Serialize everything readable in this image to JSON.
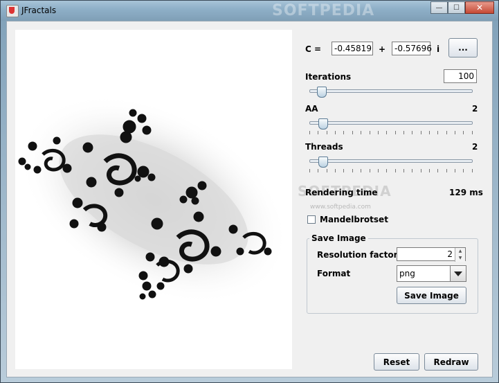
{
  "window": {
    "title": "JFractals",
    "buttons": {
      "minimize": "—",
      "maximize": "☐",
      "close": "✕"
    }
  },
  "constant": {
    "label": "C =",
    "real": "-0.45819",
    "plus": "+",
    "imag": "-0.57696",
    "i_label": "i",
    "browse_label": "..."
  },
  "iterations": {
    "label": "Iterations",
    "value": "100",
    "slider_fraction": 0.05
  },
  "aa": {
    "label": "AA",
    "value": "2",
    "slider_fraction": 0.06
  },
  "threads": {
    "label": "Threads",
    "value": "2",
    "slider_fraction": 0.06
  },
  "rendering": {
    "label": "Rendering time",
    "value": "129 ms"
  },
  "mandelbrot": {
    "label": "Mandelbrotset",
    "checked": false
  },
  "save_image": {
    "title": "Save Image",
    "resolution_label": "Resolution factor",
    "resolution_value": "2",
    "format_label": "Format",
    "format_value": "png",
    "save_button": "Save Image"
  },
  "actions": {
    "reset": "Reset",
    "redraw": "Redraw"
  },
  "watermark": {
    "title": "SOFTPEDIA",
    "side": "SOFTPEDIA",
    "url": "www.softpedia.com"
  }
}
